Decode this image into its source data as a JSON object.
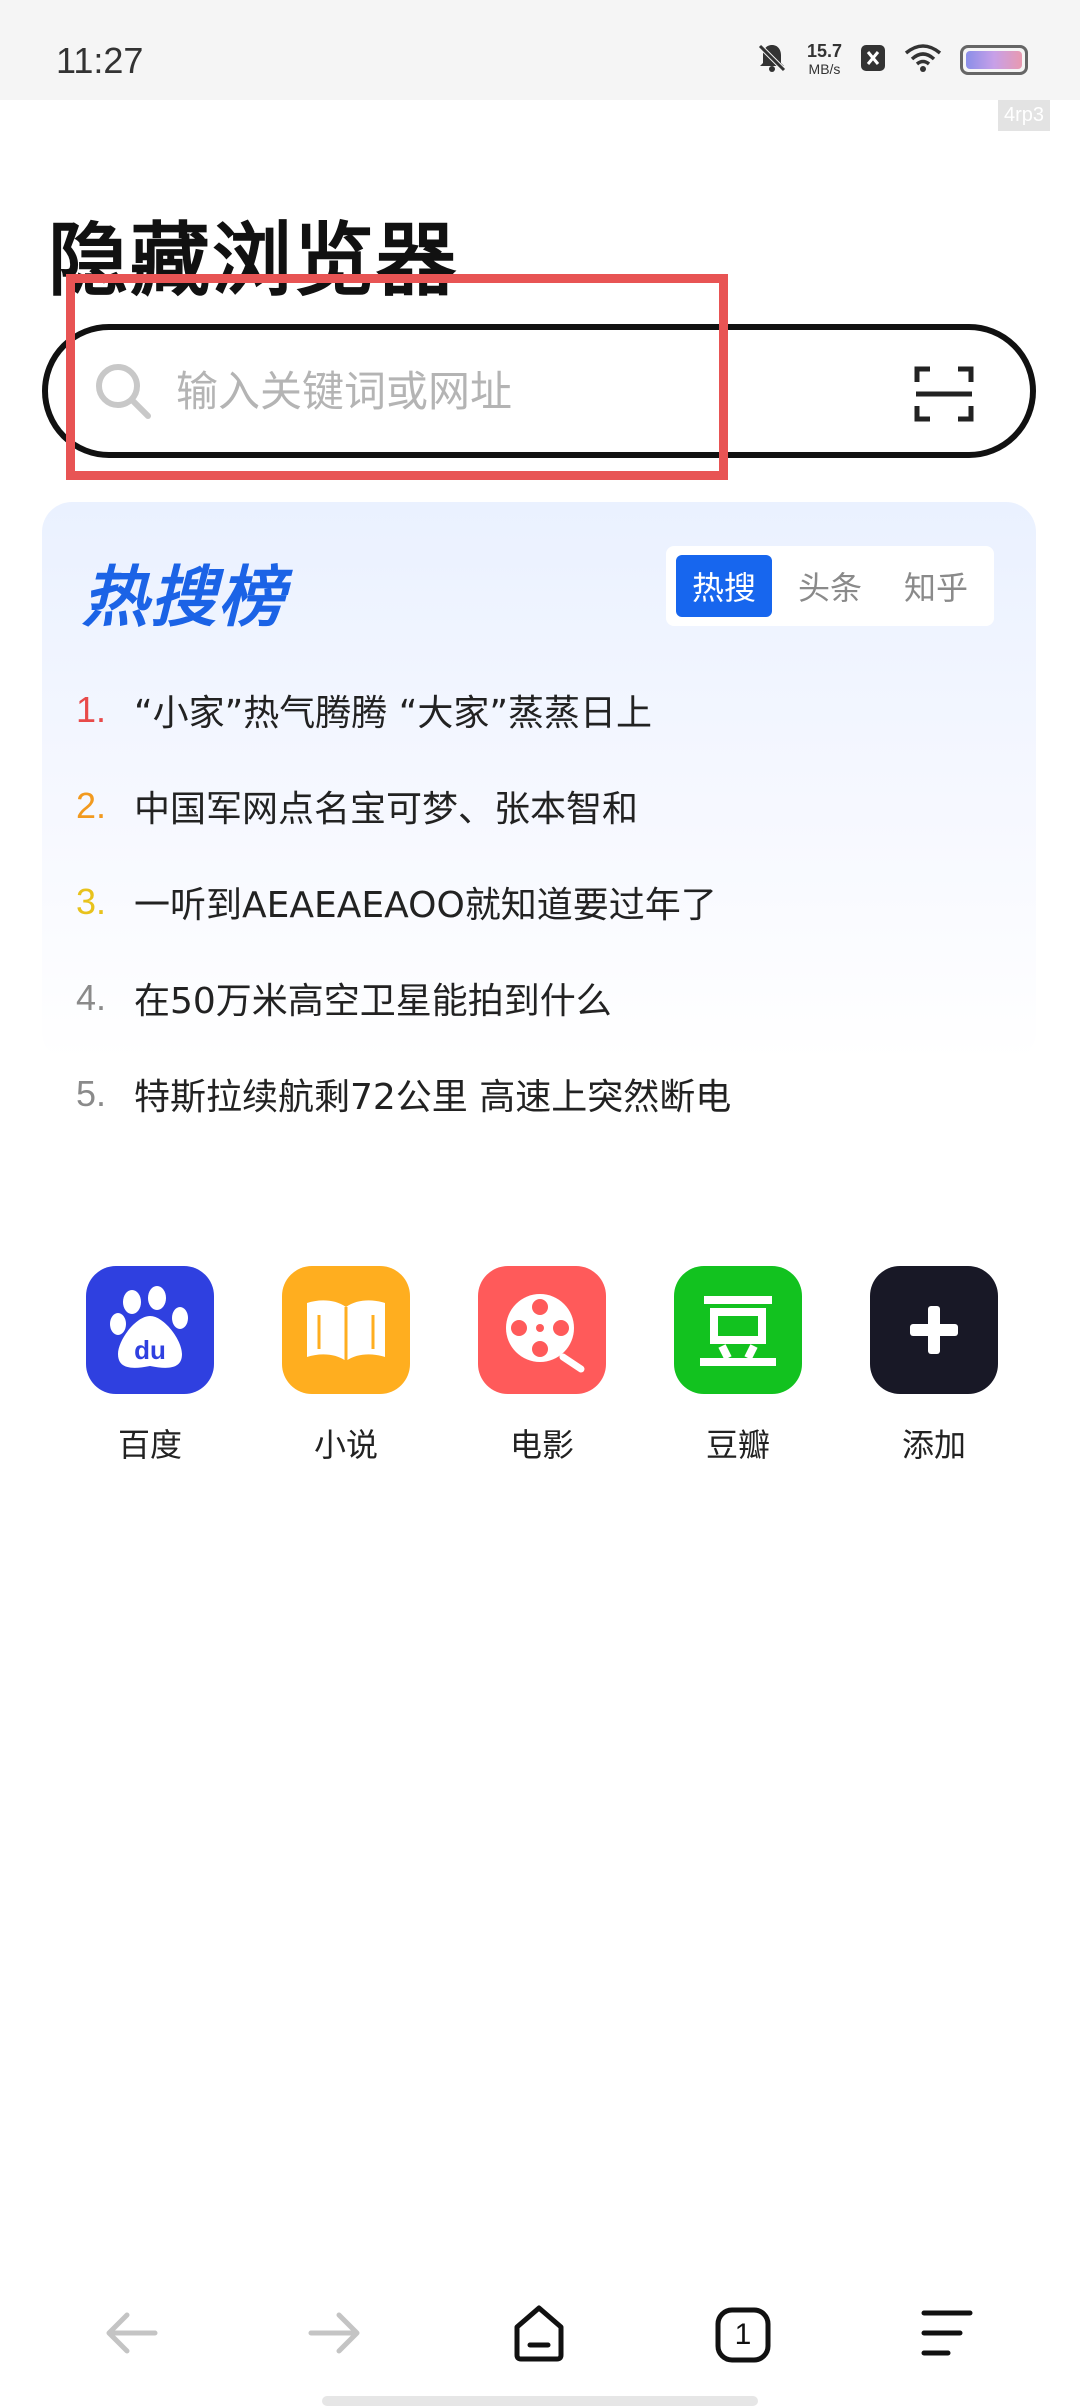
{
  "status_bar": {
    "time": "11:27",
    "net_speed_value": "15.7",
    "net_speed_unit": "MB/s",
    "icons": [
      "bell-muted-icon",
      "close-badge-icon",
      "wifi-icon",
      "battery-icon"
    ]
  },
  "watermark": "4rp3",
  "app_title": "隐藏浏览器",
  "search": {
    "placeholder": "输入关键词或网址",
    "value": ""
  },
  "hot_list": {
    "title": "热搜榜",
    "tabs": [
      {
        "label": "热搜",
        "active": true
      },
      {
        "label": "头条",
        "active": false
      },
      {
        "label": "知乎",
        "active": false
      }
    ],
    "items": [
      {
        "rank": "1.",
        "text": "“小家”热气腾腾 “大家”蒸蒸日上",
        "rank_color": "#e84a4a"
      },
      {
        "rank": "2.",
        "text": "中国军网点名宝可梦、张本智和",
        "rank_color": "#f29a1f"
      },
      {
        "rank": "3.",
        "text": "一听到AEAEAEAOO就知道要过年了",
        "rank_color": "#e8c21c"
      },
      {
        "rank": "4.",
        "text": "在50万米高空卫星能拍到什么",
        "rank_color": "#8a8a8a"
      },
      {
        "rank": "5.",
        "text": "特斯拉续航剩72公里 高速上突然断电",
        "rank_color": "#8a8a8a"
      }
    ]
  },
  "shortcuts": [
    {
      "label": "百度",
      "icon": "baidu-paw-icon",
      "color": "#2f40e0"
    },
    {
      "label": "小说",
      "icon": "book-icon",
      "color": "#ffae1f"
    },
    {
      "label": "电影",
      "icon": "film-reel-icon",
      "color": "#ff5a5a"
    },
    {
      "label": "豆瓣",
      "icon": "douban-icon",
      "color": "#12c21f"
    },
    {
      "label": "添加",
      "icon": "plus-icon",
      "color": "#181826"
    }
  ],
  "bottom_nav": {
    "tab_count": "1",
    "icons": [
      "back-arrow-icon",
      "forward-arrow-icon",
      "home-icon",
      "tabs-icon",
      "menu-icon"
    ]
  }
}
